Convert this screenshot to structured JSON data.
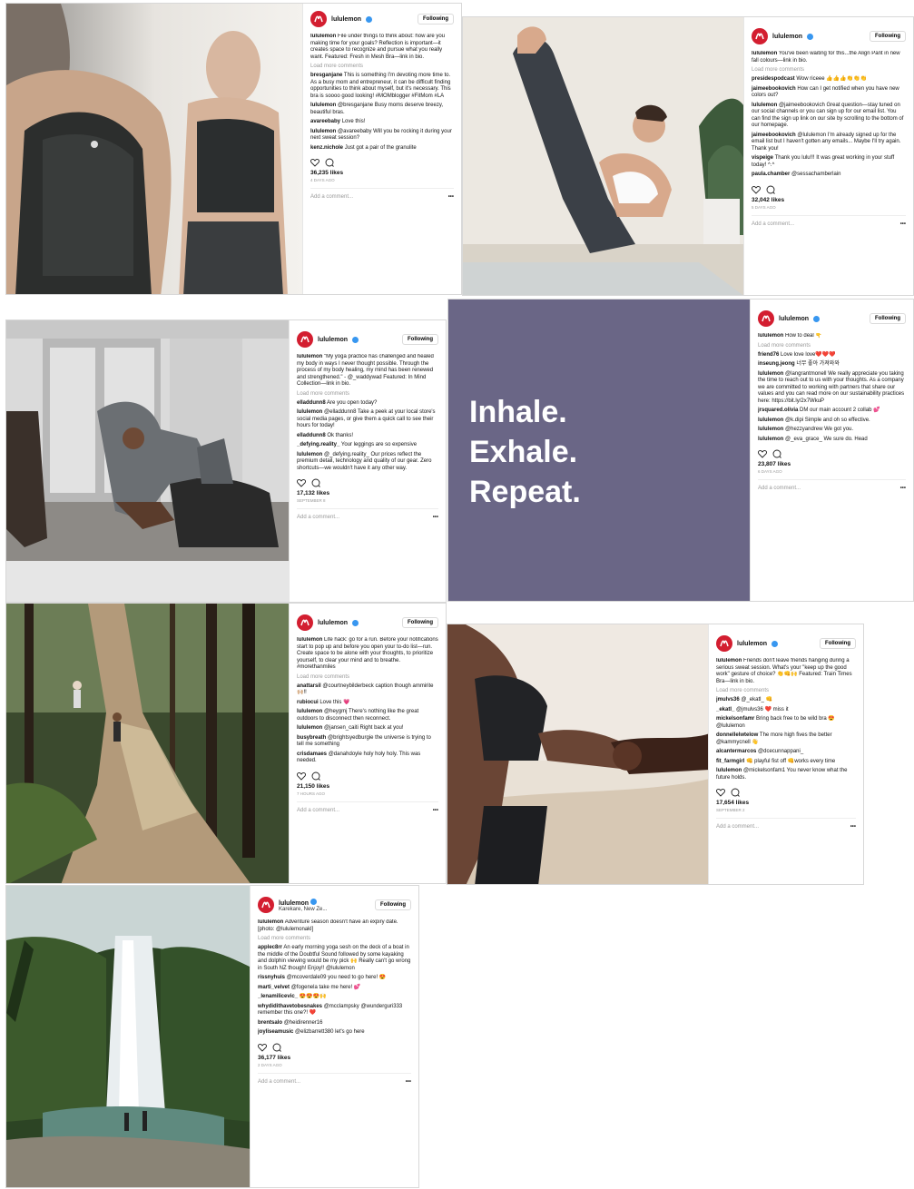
{
  "account": "lululemon",
  "follow_label": "Following",
  "load_more": "Load more comments",
  "add_comment": "Add a comment...",
  "more": "•••",
  "posts": [
    {
      "caption": "File under things to think about: how are you making time for your goals? Reflection is important—it creates space to recognize and pursue what you really want. Featured: Fresh in Mesh Bra—link in bio.",
      "comments": [
        {
          "user": "bresganjane",
          "text": "This is something I'm devoting more time to. As a busy mom and entrepreneur, it can be difficult finding opportunities to think about myself, but it's necessary. This bra is soooo good looking! #MOMblogger #FitMom #LA"
        },
        {
          "user": "lululemon",
          "text": "@bresganjane Busy moms deserve breezy, beautiful bras."
        },
        {
          "user": "avareebaby",
          "text": "Love this!"
        },
        {
          "user": "lululemon",
          "text": "@avareebaby Will you be rocking it during your next sweat session?"
        },
        {
          "user": "kenz.nichole",
          "text": "Just got a pair of the granulite"
        }
      ],
      "likes": "36,235 likes",
      "age": "4 DAYS AGO"
    },
    {
      "caption": "You've been waiting for this...the Align Pant in new fall colours—link in bio.",
      "comments": [
        {
          "user": "presidespodcast",
          "text": "Wow riceee 👍👍👍👏👏👏"
        },
        {
          "user": "jaimeebookovich",
          "text": "How can I get notified when you have new colors out?"
        },
        {
          "user": "lululemon",
          "text": "@jaimeebookovich Great question—stay tuned on our social channels or you can sign up for our email list. You can find the sign up link on our site by scrolling to the bottom of our homepage."
        },
        {
          "user": "jaimeebookovich",
          "text": "@lululemon I'm already signed up for the email list but I haven't gotten any emails... Maybe I'll try again. Thank you!"
        },
        {
          "user": "vispeige",
          "text": "Thank you lulu!!! It was great working in your stuff today! ^.^"
        },
        {
          "user": "paula.chamber",
          "text": "@sessachamberlain"
        }
      ],
      "likes": "32,042 likes",
      "age": "5 DAYS AGO"
    },
    {
      "caption": "\"My yoga practice has challenged and healed my body in ways I never thought possible. Through the process of my body healing, my mind has been renewed and strengthened.\" - @_waddywad Featured: In Mind Collection—link in bio.",
      "comments": [
        {
          "user": "elladdunn8",
          "text": "Are you open today?"
        },
        {
          "user": "lululemon",
          "text": "@elladdunn8 Take a peek at your local store's social media pages, or give them a quick call to see their hours for today!"
        },
        {
          "user": "elladdunn8",
          "text": "Ok thanks!"
        },
        {
          "user": "_defying.reality_",
          "text": "Your leggings are so expensive"
        },
        {
          "user": "lululemon",
          "text": "@_defying.reality_ Our prices reflect the premium detail, technology and quality of our gear. Zero shortcuts—we wouldn't have it any other way."
        }
      ],
      "likes": "17,132 likes",
      "age": "SEPTEMBER 8"
    },
    {
      "image_text": [
        "Inhale.",
        "Exhale.",
        "Repeat."
      ],
      "caption": "How to deal 👇",
      "comments": [
        {
          "user": "friend76",
          "text": "Love love love❤️❤️❤️"
        },
        {
          "user": "inseung.jeong",
          "text": "너무 좋아 가져와와"
        },
        {
          "user": "lululemon",
          "text": "@langrantmonell We really appreciate you taking the time to reach out to us with your thoughts. As a company we are committed to working with partners that share our values and you can read more on our sustainability practices here: https://bit.ly/2x7WkuP"
        },
        {
          "user": "jrsquared.olivia",
          "text": "DM our main account 2 collab 💕"
        },
        {
          "user": "lululemon",
          "text": "@k.dipi Simple and oh so effective."
        },
        {
          "user": "lululemon",
          "text": "@hezzyandrew We got you."
        },
        {
          "user": "lululemon",
          "text": "@_eva_grace_ We sure do. Head"
        }
      ],
      "likes": "23,807 likes",
      "age": "6 DAYS AGO"
    },
    {
      "caption": "Life hack: go for a run. Before your notifications start to pop up and before you open your to-do list—run. Create space to be alone with your thoughts, to prioritize yourself, to clear your mind and to breathe. #morethanmiles",
      "comments": [
        {
          "user": "anattarsil",
          "text": "@courtneybilderbeck caption though ammirite 🙌🏼!!"
        },
        {
          "user": "rubiocui",
          "text": "Love this 💗"
        },
        {
          "user": "lululemon",
          "text": "@heygmj There's nothing like the great outdoors to disconnect then reconnect."
        },
        {
          "user": "lululemon",
          "text": "@jansen_caiti Right back at you!"
        },
        {
          "user": "busybreath",
          "text": "@brightsyedburgie the universe is trying to tell me something"
        },
        {
          "user": "crisdamaes",
          "text": "@danahdoyle holy holy holy. This was needed."
        }
      ],
      "likes": "21,150 likes",
      "age": "7 HOURS AGO"
    },
    {
      "caption": "Friends don't leave friends hanging during a serious sweat session. What's your \"keep up the good work\" gesture of choice? 👏👊🙌 Featured: Train Times Bra—link in bio.",
      "comments": [
        {
          "user": "jmulvs36",
          "text": "@_ekatl_ 👊"
        },
        {
          "user": "_ekatl_",
          "text": "@jmulvs36 ❤️ miss it"
        },
        {
          "user": "mickelsonfamr",
          "text": "Bring back free to be wild bra 😍 @lululemon"
        },
        {
          "user": "donnellelwtelow",
          "text": "The more high fives the better @kammycnell 👋"
        },
        {
          "user": "alcantermarcos",
          "text": "@dcecunnappani_"
        },
        {
          "user": "fit_farmgirl",
          "text": "👊 playful fist off 👊works every time"
        },
        {
          "user": "lululemon",
          "text": "@mickelsonfam1 You never know what the future holds."
        }
      ],
      "likes": "17,654 likes",
      "age": "SEPTEMBER 2"
    },
    {
      "location": "Karekare, New Ze...",
      "caption": "Adventure season doesn't have an expiry date. [photo: @lululemonakl]",
      "comments": [
        {
          "user": "applec8rr",
          "text": "An early morning yoga sesh on the deck of a boat in the middle of the Doubtful Sound followed by some kayaking and dolphin viewing would be my pick 🙌 Really can't go wrong in South NZ though! Enjoy!! @lululemon"
        },
        {
          "user": "rissnyhuis",
          "text": "@mcoverdale09 you need to go here! 😍"
        },
        {
          "user": "marti_velvet",
          "text": "@fogenela take me here! 💕"
        },
        {
          "user": "_lenamilicevic_",
          "text": "😍😍😍🙌"
        },
        {
          "user": "whydidithavetobesnakes",
          "text": "@mcclampsky @wunderguri333 remember this one?! ❤️"
        },
        {
          "user": "brentsalo",
          "text": "@heidirenner16"
        },
        {
          "user": "joyliseamusic",
          "text": "@elizbarrett380 let's go here"
        }
      ],
      "likes": "36,177 likes",
      "age": "2 DAYS AGO"
    }
  ],
  "colors": {
    "brand_red": "#d31e30",
    "verified_blue": "#3897f0",
    "mention_blue": "#2a5db0",
    "quote_panel": "#6a6686"
  }
}
